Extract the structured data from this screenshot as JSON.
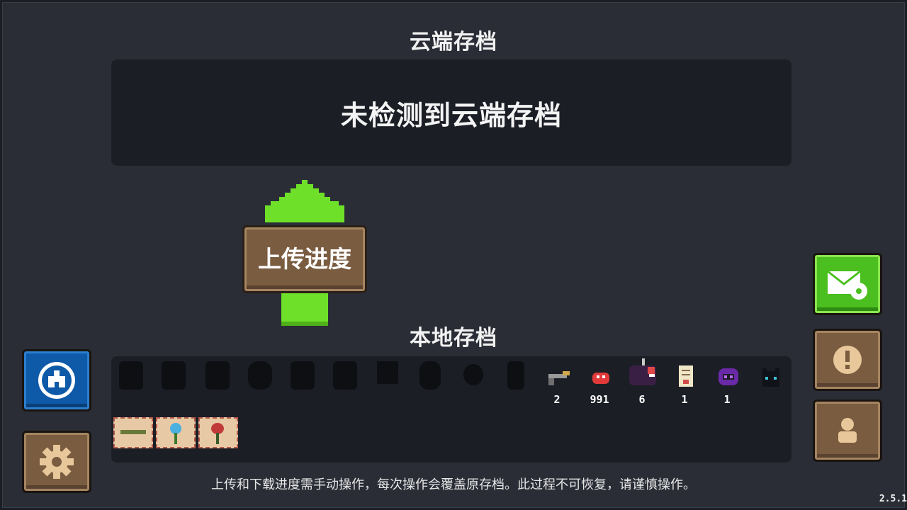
{
  "cloud": {
    "title": "云端存档",
    "message": "未检测到云端存档"
  },
  "upload_button": {
    "label": "上传进度"
  },
  "local": {
    "title": "本地存档",
    "locked_characters": [
      "locked-character-1",
      "locked-character-2",
      "locked-character-3",
      "locked-character-4",
      "locked-character-5",
      "locked-character-6",
      "locked-character-7",
      "locked-character-8",
      "locked-character-9",
      "locked-character-10"
    ],
    "items": [
      {
        "icon": "pistol-icon",
        "count": "2"
      },
      {
        "icon": "red-slime-icon",
        "count": "991"
      },
      {
        "icon": "dark-boss-icon",
        "count": "6"
      },
      {
        "icon": "scroll-icon",
        "count": "1"
      },
      {
        "icon": "purple-helmet-icon",
        "count": "1"
      },
      {
        "icon": "black-cat-icon",
        "count": ""
      }
    ],
    "cards": [
      "gun-card-icon",
      "plant-card-icon",
      "flower-card-icon"
    ]
  },
  "disclaimer": "上传和下载进度需手动操作，每次操作会覆盖原存档。此过程不可恢复，请谨慎操作。",
  "version": "2.5.1",
  "colors": {
    "accent_green": "#6ee02a",
    "wood": "#7a5c40",
    "panel": "#1b1e25",
    "background": "#2a2d36"
  }
}
